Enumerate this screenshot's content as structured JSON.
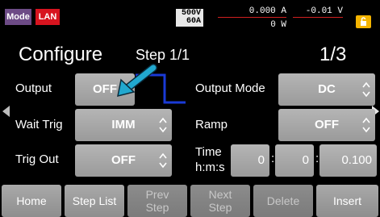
{
  "status": {
    "mode_label": "Mode",
    "lan_label": "LAN",
    "voltage_limit": "500V",
    "current_limit": "60A",
    "current_reading": "0.000 A",
    "voltage_reading": "-0.01 V",
    "power_reading": "0 W",
    "lock_icon": "lock-icon"
  },
  "header": {
    "title": "Configure",
    "step": "Step 1/1",
    "page": "1/3"
  },
  "fields": {
    "output_label": "Output",
    "output_value": "OFF",
    "output_mode_label": "Output Mode",
    "output_mode_value": "DC",
    "wait_trig_label": "Wait Trig",
    "wait_trig_value": "IMM",
    "ramp_label": "Ramp",
    "ramp_value": "OFF",
    "trig_out_label": "Trig Out",
    "trig_out_value": "OFF",
    "time_label_1": "Time",
    "time_label_2": "h:m:s",
    "time_h": "0",
    "time_m": "0",
    "time_s": "0.100"
  },
  "footer": {
    "home": "Home",
    "step_list": "Step List",
    "prev_step_1": "Prev",
    "prev_step_2": "Step",
    "next_step_1": "Next",
    "next_step_2": "Step",
    "delete": "Delete",
    "insert": "Insert"
  },
  "colors": {
    "mode_badge": "#6d4b86",
    "lan_badge": "#d7141f",
    "lock": "#f4b400",
    "annotation_arrow": "#21a8cf",
    "annotation_line": "#1a3ad6"
  }
}
